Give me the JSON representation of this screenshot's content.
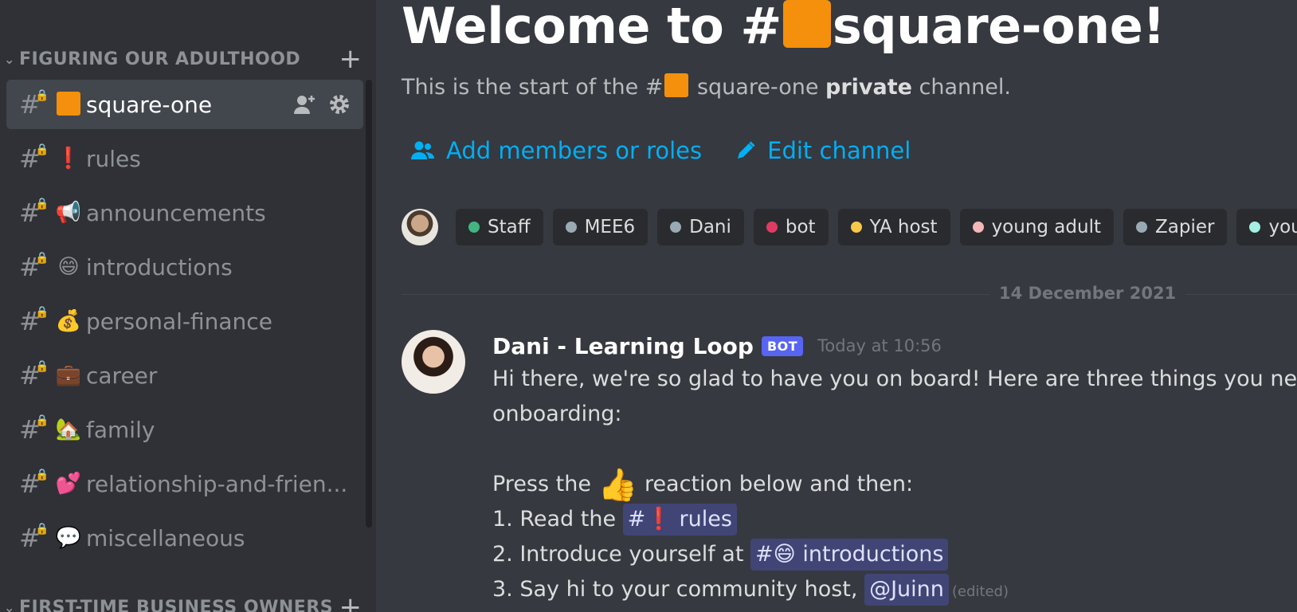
{
  "sidebar": {
    "category": {
      "label": "FIGURING OUR ADULTHOOD"
    },
    "channels": [
      {
        "name": "square-one",
        "emoji": "",
        "active": true
      },
      {
        "name": "rules",
        "emoji": "❗",
        "active": false
      },
      {
        "name": "announcements",
        "emoji": "📢",
        "active": false
      },
      {
        "name": "introductions",
        "emoji": "😄",
        "active": false
      },
      {
        "name": "personal-finance",
        "emoji": "💰",
        "active": false
      },
      {
        "name": "career",
        "emoji": "💼",
        "active": false
      },
      {
        "name": "family",
        "emoji": "🏡",
        "active": false
      },
      {
        "name": "relationship-and-frien...",
        "emoji": "💕",
        "active": false
      },
      {
        "name": "miscellaneous",
        "emoji": "💬",
        "active": false
      }
    ],
    "next_category": {
      "label": "FIRST-TIME BUSINESS OWNERS"
    }
  },
  "main": {
    "welcome_prefix": "Welcome to #",
    "welcome_suffix": "square-one!",
    "subtitle_prefix": "This is the start of the #",
    "subtitle_channel": " square-one ",
    "subtitle_bold": "private",
    "subtitle_suffix": " channel.",
    "actions": {
      "add_members": "Add members or roles",
      "edit_channel": "Edit channel"
    },
    "roles": [
      {
        "label": "Staff",
        "color": "#43b581"
      },
      {
        "label": "MEE6",
        "color": "#99aab5"
      },
      {
        "label": "Dani",
        "color": "#99aab5"
      },
      {
        "label": "bot",
        "color": "#e03c63"
      },
      {
        "label": "YA host",
        "color": "#f7c948"
      },
      {
        "label": "young adult",
        "color": "#f4b6b6"
      },
      {
        "label": "Zapier",
        "color": "#99aab5"
      },
      {
        "label": "young ac",
        "color": "#a5f0e0"
      }
    ],
    "date_divider": "14 December 2021",
    "message": {
      "author": "Dani - Learning Loop",
      "bot_tag": "BOT",
      "timestamp": "Today at 10:56",
      "line1": "Hi there, we're so glad to have you on board! Here are three things you need",
      "line2": "onboarding:",
      "press_prefix": "Press the ",
      "press_emoji": "👍",
      "press_suffix": " reaction below and then:",
      "step1_prefix": "1. Read the ",
      "step1_mention": "#❗ rules",
      "step2_prefix": "2. Introduce yourself at ",
      "step2_mention": "#😄 introductions",
      "step3_prefix": "3. Say hi to your community host, ",
      "step3_mention": "@Juinn",
      "edited": "(edited)"
    }
  },
  "colors": {
    "sidebar_bg": "#2f3136",
    "main_bg": "#36393f",
    "link": "#00aff4",
    "bot_tag": "#5865f2"
  },
  "icons": [
    "chevron-down-icon",
    "plus-icon",
    "hash-lock-icon",
    "add-member-icon",
    "gear-icon",
    "people-icon",
    "pencil-icon"
  ]
}
